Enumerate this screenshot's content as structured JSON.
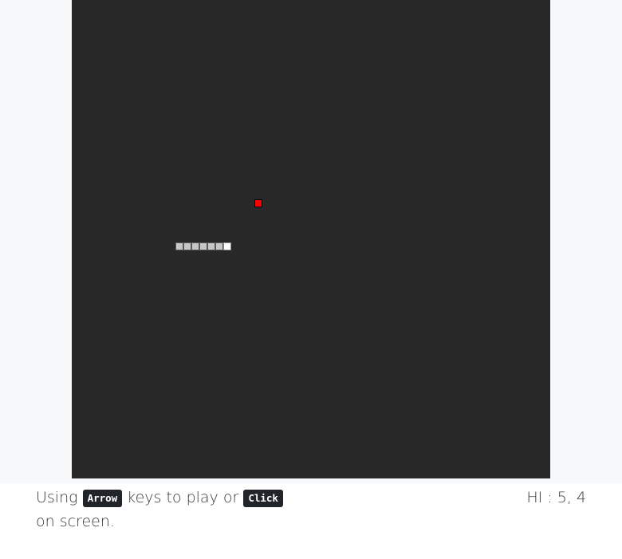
{
  "game": {
    "snake_segment_count": 7,
    "food_color": "#ff0000",
    "snake_body_color": "#c7c7c7",
    "snake_head_color": "#ffffff",
    "board_color": "#282828"
  },
  "footer": {
    "instruction_prefix": "Using",
    "key_arrow": "Arrow",
    "instruction_middle": "keys to play or",
    "key_click": "Click",
    "instruction_suffix": "on screen.",
    "hiscore_label": "HI :",
    "hiscore_value": "5, 4"
  }
}
